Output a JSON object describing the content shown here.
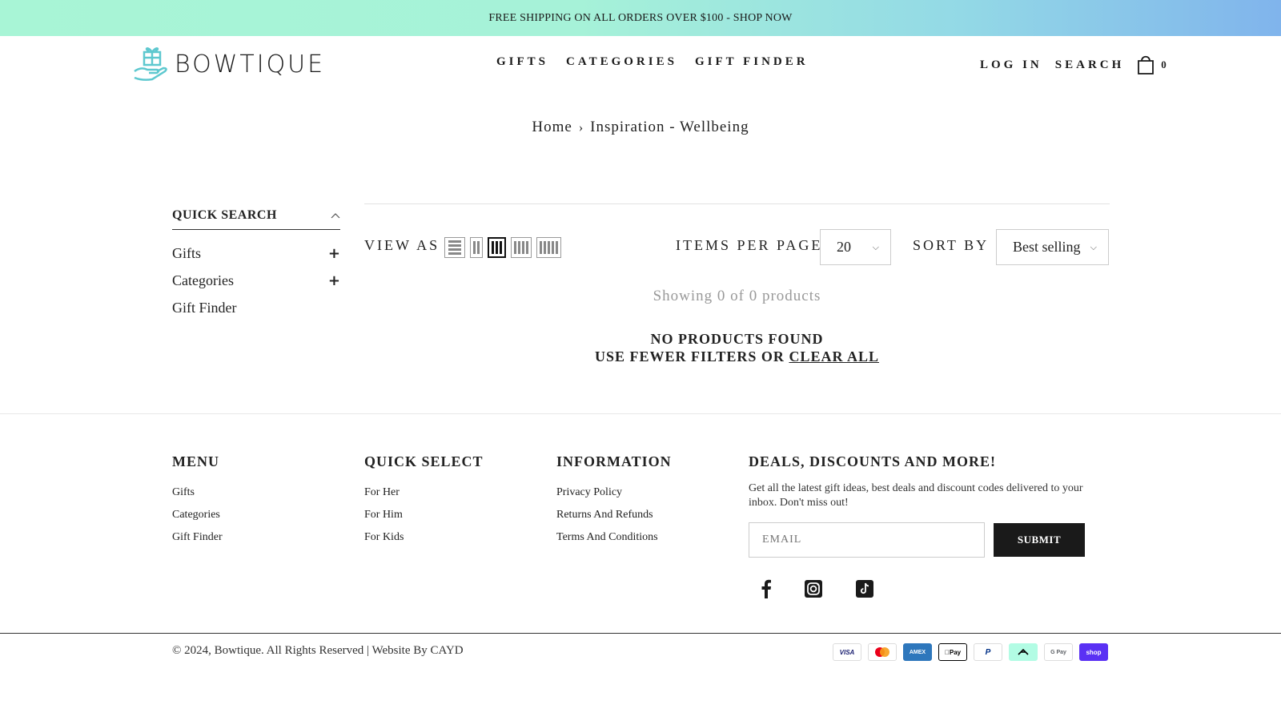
{
  "announcement": "FREE SHIPPING ON ALL ORDERS OVER $100 - SHOP NOW",
  "brand": {
    "name": "BOWTIQUE",
    "accent": "#5ec8cf"
  },
  "nav": [
    {
      "label": "GIFTS"
    },
    {
      "label": "CATEGORIES"
    },
    {
      "label": "GIFT FINDER"
    }
  ],
  "header_right": {
    "login": "LOG IN",
    "search": "SEARCH",
    "cart_count": "0"
  },
  "breadcrumb": {
    "home": "Home",
    "current": "Inspiration - Wellbeing"
  },
  "sidebar": {
    "title": "QUICK SEARCH",
    "items": [
      {
        "label": "Gifts",
        "expandable": true
      },
      {
        "label": "Categories",
        "expandable": true
      },
      {
        "label": "Gift Finder",
        "expandable": false
      }
    ]
  },
  "toolbar": {
    "view_as": "VIEW AS",
    "items_per_page_label": "ITEMS PER PAGE",
    "items_per_page_value": "20",
    "sort_by_label": "SORT BY",
    "sort_by_value": "Best selling"
  },
  "results": {
    "showing": "Showing 0 of 0 products",
    "no_products": "NO PRODUCTS FOUND",
    "fewer_filters": "USE FEWER FILTERS OR",
    "clear_all": "CLEAR ALL"
  },
  "footer": {
    "menu": {
      "title": "MENU",
      "links": [
        "Gifts",
        "Categories",
        "Gift Finder"
      ]
    },
    "quick_select": {
      "title": "QUICK SELECT",
      "links": [
        "For Her",
        "For Him",
        "For Kids"
      ]
    },
    "information": {
      "title": "INFORMATION",
      "links": [
        "Privacy Policy",
        "Returns And Refunds",
        "Terms And Conditions"
      ]
    },
    "deals": {
      "title": "DEALS, DISCOUNTS AND MORE!",
      "text": "Get all the latest gift ideas, best deals and discount codes delivered to your inbox. Don't miss out!",
      "email_placeholder": "EMAIL",
      "submit": "SUBMIT"
    },
    "social_icons": [
      "facebook-icon",
      "instagram-icon",
      "tiktok-icon"
    ],
    "copyright": "© 2024, Bowtique. All Rights Reserved | Website By CAYD",
    "payments": [
      {
        "name": "visa",
        "label": "VISA",
        "color": "#1a1f71"
      },
      {
        "name": "mastercard",
        "label": "",
        "color": "#eb001b"
      },
      {
        "name": "amex",
        "label": "AMEX",
        "color": "#2e77bc"
      },
      {
        "name": "apple-pay",
        "label": "Pay",
        "color": "#000000"
      },
      {
        "name": "paypal",
        "label": "P",
        "color": "#003087"
      },
      {
        "name": "afterpay",
        "label": "",
        "color": "#b2fce4"
      },
      {
        "name": "google-pay",
        "label": "G Pay",
        "color": "#5f6368"
      },
      {
        "name": "shop-pay",
        "label": "shop",
        "color": "#5a31f4"
      }
    ]
  }
}
